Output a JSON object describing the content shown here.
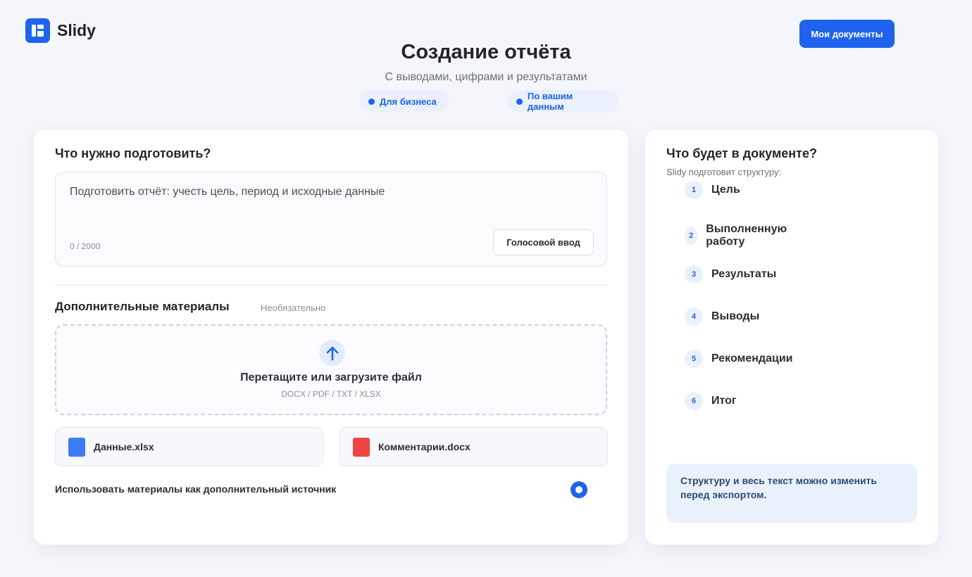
{
  "brand": {
    "name": "Slidy",
    "logo_icon": "slidy-logo-icon"
  },
  "header": {
    "docs_button": "Мои документы",
    "title": "Создание отчёта",
    "subtitle": "С выводами, цифрами и результатами",
    "chips": [
      "Для бизнеса",
      "По вашим данным"
    ]
  },
  "left": {
    "prompt_title": "Что нужно подготовить?",
    "prompt_text": "Подготовить отчёт: учесть цель, период и исходные данные",
    "counter": "0 / 2000",
    "voice_button": "Голосовой ввод",
    "materials_title": "Дополнительные материалы",
    "materials_optional": "Необязательно",
    "drop_title": "Перетащите или загрузите файл",
    "drop_formats": "DOCX / PDF / TXT / XLSX",
    "files": [
      {
        "name": "Данные.xlsx",
        "color": "#3b7cf6"
      },
      {
        "name": "Комментарии.docx",
        "color": "#ef4545"
      }
    ],
    "use_materials_label": "Использовать материалы как дополнительный источник"
  },
  "right": {
    "title": "Что будет в документе?",
    "subtitle": "Slidy подготовит структуру:",
    "steps": [
      {
        "num": "1",
        "label": "Цель"
      },
      {
        "num": "2",
        "label": "Выполненную работу"
      },
      {
        "num": "3",
        "label": "Результаты"
      },
      {
        "num": "4",
        "label": "Выводы"
      },
      {
        "num": "5",
        "label": "Рекомендации"
      },
      {
        "num": "6",
        "label": "Итог"
      }
    ],
    "note": "Структуру и весь текст можно изменить перед экспортом."
  },
  "colors": {
    "accent": "#1e63ee",
    "background": "#f4f6fb"
  }
}
